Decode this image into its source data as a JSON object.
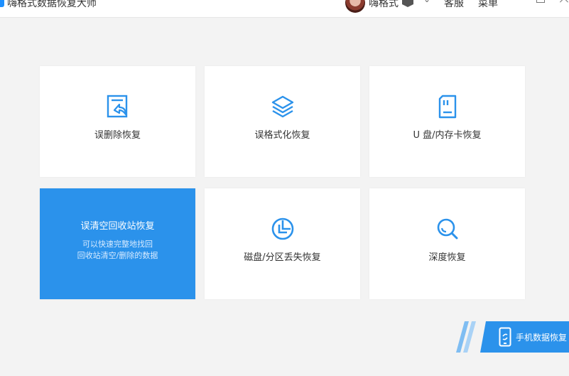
{
  "titlebar": {
    "app_title": "嗨格式数据恢复大师",
    "user_name": "嗨格式",
    "service": "客服",
    "menu": "菜单"
  },
  "cards": [
    {
      "label": "误删除恢复",
      "icon": "file-undo-icon"
    },
    {
      "label": "误格式化恢复",
      "icon": "layers-icon"
    },
    {
      "label": "U 盘/内存卡恢复",
      "icon": "sd-card-icon"
    },
    {
      "label": "误清空回收站恢复",
      "desc_line1": "可以快速完整地找回",
      "desc_line2": "回收站清空/删除的数据",
      "active": true
    },
    {
      "label": "磁盘/分区丢失恢复",
      "icon": "pie-chart-icon"
    },
    {
      "label": "深度恢复",
      "icon": "magnifier-icon"
    }
  ],
  "phone_tab": {
    "label": "手机数据恢复"
  },
  "colors": {
    "accent": "#2b92eb",
    "background": "#f3f3f3",
    "card": "#ffffff"
  }
}
